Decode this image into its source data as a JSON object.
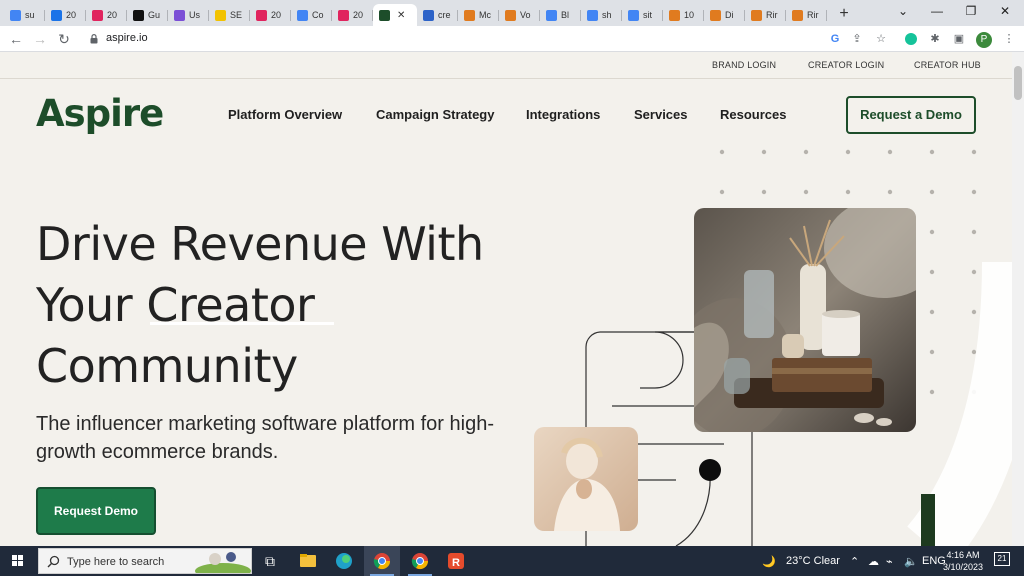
{
  "browser": {
    "tabs": [
      {
        "label": "su",
        "icon": "google-icon",
        "color": "#4285f4"
      },
      {
        "label": "20",
        "icon": "blue-diamond-icon",
        "color": "#1a73e8"
      },
      {
        "label": "20",
        "icon": "red-star-icon",
        "color": "#e0245e"
      },
      {
        "label": "Gu",
        "icon": "a-icon",
        "color": "#111111"
      },
      {
        "label": "Us",
        "icon": "purple-circle-icon",
        "color": "#7b4fd6"
      },
      {
        "label": "SE",
        "icon": "pencil-icon",
        "color": "#f2c200"
      },
      {
        "label": "20",
        "icon": "red-star-icon",
        "color": "#e0245e"
      },
      {
        "label": "Co",
        "icon": "docs-icon",
        "color": "#4285f4"
      },
      {
        "label": "20",
        "icon": "red-star-icon",
        "color": "#e0245e"
      },
      {
        "label": "",
        "icon": "aspire-icon",
        "color": "#1d4d2a",
        "active": true
      },
      {
        "label": "cre",
        "icon": "wave-icon",
        "color": "#2d63c8"
      },
      {
        "label": "Mc",
        "icon": "r-icon",
        "color": "#e07b1f"
      },
      {
        "label": "Vo",
        "icon": "r-icon",
        "color": "#e07b1f"
      },
      {
        "label": "Bl",
        "icon": "docs-icon",
        "color": "#4285f4"
      },
      {
        "label": "sh",
        "icon": "google-icon",
        "color": "#4285f4"
      },
      {
        "label": "sit",
        "icon": "google-icon",
        "color": "#4285f4"
      },
      {
        "label": "10",
        "icon": "r-icon",
        "color": "#e07b1f"
      },
      {
        "label": "Di",
        "icon": "r-icon",
        "color": "#e07b1f"
      },
      {
        "label": "Rir",
        "icon": "r-icon",
        "color": "#e07b1f"
      },
      {
        "label": "Rir",
        "icon": "r-icon",
        "color": "#e07b1f"
      }
    ],
    "new_tab": "+",
    "url": "aspire.io",
    "profile_initial": "P"
  },
  "page": {
    "utility_links": [
      "BRAND LOGIN",
      "CREATOR LOGIN",
      "CREATOR HUB"
    ],
    "logo": "Aspire",
    "nav": [
      "Platform Overview",
      "Campaign Strategy",
      "Integrations",
      "Services",
      "Resources"
    ],
    "cta_top": "Request a Demo",
    "headline": [
      "Drive Revenue With",
      "Your Creator",
      "Community"
    ],
    "subheadline": "The influencer marketing software platform for high-growth ecommerce brands.",
    "cta_main": "Request Demo",
    "brand_color": "#1d4d2a",
    "cta_color": "#1e7b4a"
  },
  "taskbar": {
    "search_placeholder": "Type here to search",
    "weather": "23°C  Clear",
    "time": "4:16 AM",
    "date": "3/10/2023",
    "notifications": "21"
  }
}
